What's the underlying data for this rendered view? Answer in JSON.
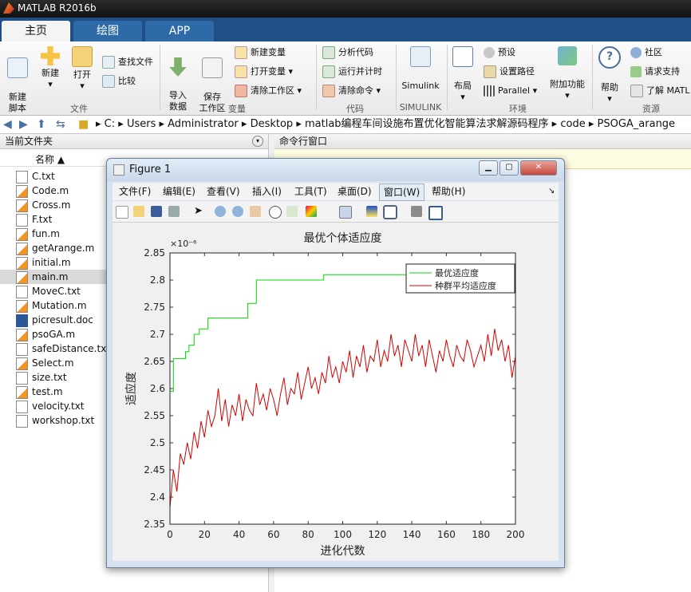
{
  "window": {
    "title": "MATLAB R2016b"
  },
  "tabs": [
    "主页",
    "绘图",
    "APP"
  ],
  "ribbon": {
    "file_group": {
      "new_script": "新建\n脚本",
      "new": "新建",
      "open": "打开",
      "find_files": "查找文件",
      "compare": "比较",
      "label": "文件"
    },
    "variable_group": {
      "import": "导入\n数据",
      "save": "保存\n工作区",
      "new_var": "新建变量",
      "open_var": "打开变量",
      "clear_ws": "清除工作区",
      "label": "变量"
    },
    "code_group": {
      "analyze": "分析代码",
      "run_time": "运行并计时",
      "clear_cmd": "清除命令",
      "label": "代码"
    },
    "simulink_group": {
      "simulink": "Simulink",
      "label": "SIMULINK"
    },
    "env_group": {
      "layout": "布局",
      "prefs": "预设",
      "set_path": "设置路径",
      "parallel": "Parallel",
      "label": "环境"
    },
    "addons": {
      "label": "附加功能"
    },
    "resources": {
      "help": "帮助",
      "community": "社区",
      "support": "请求支持",
      "learn": "了解 MATL",
      "label": "资源"
    }
  },
  "address": [
    "C:",
    "Users",
    "Administrator",
    "Desktop",
    "matlab编程车间设施布置优化智能算法求解源码程序",
    "code",
    "PSOGA_arange"
  ],
  "left_panel": {
    "title": "当前文件夹",
    "column": "名称 ▲",
    "files": [
      "C.txt",
      "Code.m",
      "Cross.m",
      "F.txt",
      "fun.m",
      "getArange.m",
      "initial.m",
      "main.m",
      "MoveC.txt",
      "Mutation.m",
      "picresult.doc",
      "psoGA.m",
      "safeDistance.txt",
      "Select.m",
      "size.txt",
      "test.m",
      "velocity.txt",
      "workshop.txt"
    ],
    "selected": "main.m"
  },
  "command_window": {
    "title": "命令行窗口"
  },
  "figure": {
    "title": "Figure 1",
    "menu": [
      "文件(F)",
      "编辑(E)",
      "查看(V)",
      "插入(I)",
      "工具(T)",
      "桌面(D)",
      "窗口(W)",
      "帮助(H)"
    ]
  },
  "colors": {
    "best": "#00dd00",
    "avg": "#d40000"
  },
  "chart_data": {
    "type": "line",
    "title": "最优个体适应度",
    "xlabel": "进化代数",
    "ylabel": "适应度",
    "exponent_label": "×10⁻⁶",
    "xlim": [
      0,
      200
    ],
    "ylim": [
      2.35,
      2.85
    ],
    "xticks": [
      0,
      20,
      40,
      60,
      80,
      100,
      120,
      140,
      160,
      180,
      200
    ],
    "yticks": [
      2.35,
      2.4,
      2.45,
      2.5,
      2.55,
      2.6,
      2.65,
      2.7,
      2.75,
      2.8,
      2.85
    ],
    "legend_position": "top-right",
    "series": [
      {
        "name": "最优适应度",
        "x": [
          0,
          2,
          2,
          9,
          9,
          11,
          11,
          14,
          14,
          17,
          17,
          22,
          22,
          45,
          45,
          50,
          50,
          89,
          89,
          200
        ],
        "y": [
          2.595,
          2.595,
          2.655,
          2.655,
          2.668,
          2.668,
          2.68,
          2.68,
          2.7,
          2.7,
          2.71,
          2.71,
          2.73,
          2.73,
          2.757,
          2.757,
          2.8,
          2.8,
          2.81,
          2.81
        ]
      },
      {
        "name": "种群平均适应度",
        "x": [
          0,
          2,
          4,
          6,
          8,
          10,
          12,
          14,
          16,
          18,
          20,
          22,
          24,
          26,
          28,
          30,
          32,
          34,
          36,
          38,
          40,
          42,
          44,
          46,
          48,
          50,
          52,
          54,
          56,
          58,
          60,
          62,
          64,
          66,
          68,
          70,
          72,
          74,
          76,
          78,
          80,
          82,
          84,
          86,
          88,
          90,
          92,
          94,
          96,
          98,
          100,
          102,
          104,
          106,
          108,
          110,
          112,
          114,
          116,
          118,
          120,
          122,
          124,
          126,
          128,
          130,
          132,
          134,
          136,
          138,
          140,
          142,
          144,
          146,
          148,
          150,
          152,
          154,
          156,
          158,
          160,
          162,
          164,
          166,
          168,
          170,
          172,
          174,
          176,
          178,
          180,
          182,
          184,
          186,
          188,
          190,
          192,
          194,
          196,
          198,
          200
        ],
        "y": [
          2.38,
          2.45,
          2.41,
          2.48,
          2.46,
          2.5,
          2.47,
          2.52,
          2.49,
          2.54,
          2.51,
          2.56,
          2.53,
          2.55,
          2.6,
          2.54,
          2.58,
          2.53,
          2.57,
          2.55,
          2.59,
          2.54,
          2.58,
          2.56,
          2.55,
          2.61,
          2.57,
          2.59,
          2.56,
          2.6,
          2.58,
          2.55,
          2.59,
          2.62,
          2.57,
          2.6,
          2.59,
          2.63,
          2.58,
          2.61,
          2.64,
          2.6,
          2.62,
          2.59,
          2.63,
          2.61,
          2.66,
          2.62,
          2.64,
          2.61,
          2.65,
          2.63,
          2.67,
          2.62,
          2.66,
          2.64,
          2.68,
          2.63,
          2.66,
          2.65,
          2.69,
          2.64,
          2.67,
          2.65,
          2.7,
          2.66,
          2.68,
          2.64,
          2.69,
          2.67,
          2.65,
          2.7,
          2.66,
          2.68,
          2.64,
          2.69,
          2.66,
          2.63,
          2.67,
          2.65,
          2.69,
          2.66,
          2.64,
          2.68,
          2.66,
          2.65,
          2.69,
          2.67,
          2.64,
          2.66,
          2.68,
          2.65,
          2.7,
          2.66,
          2.71,
          2.67,
          2.69,
          2.65,
          2.68,
          2.62,
          2.66
        ]
      }
    ]
  }
}
